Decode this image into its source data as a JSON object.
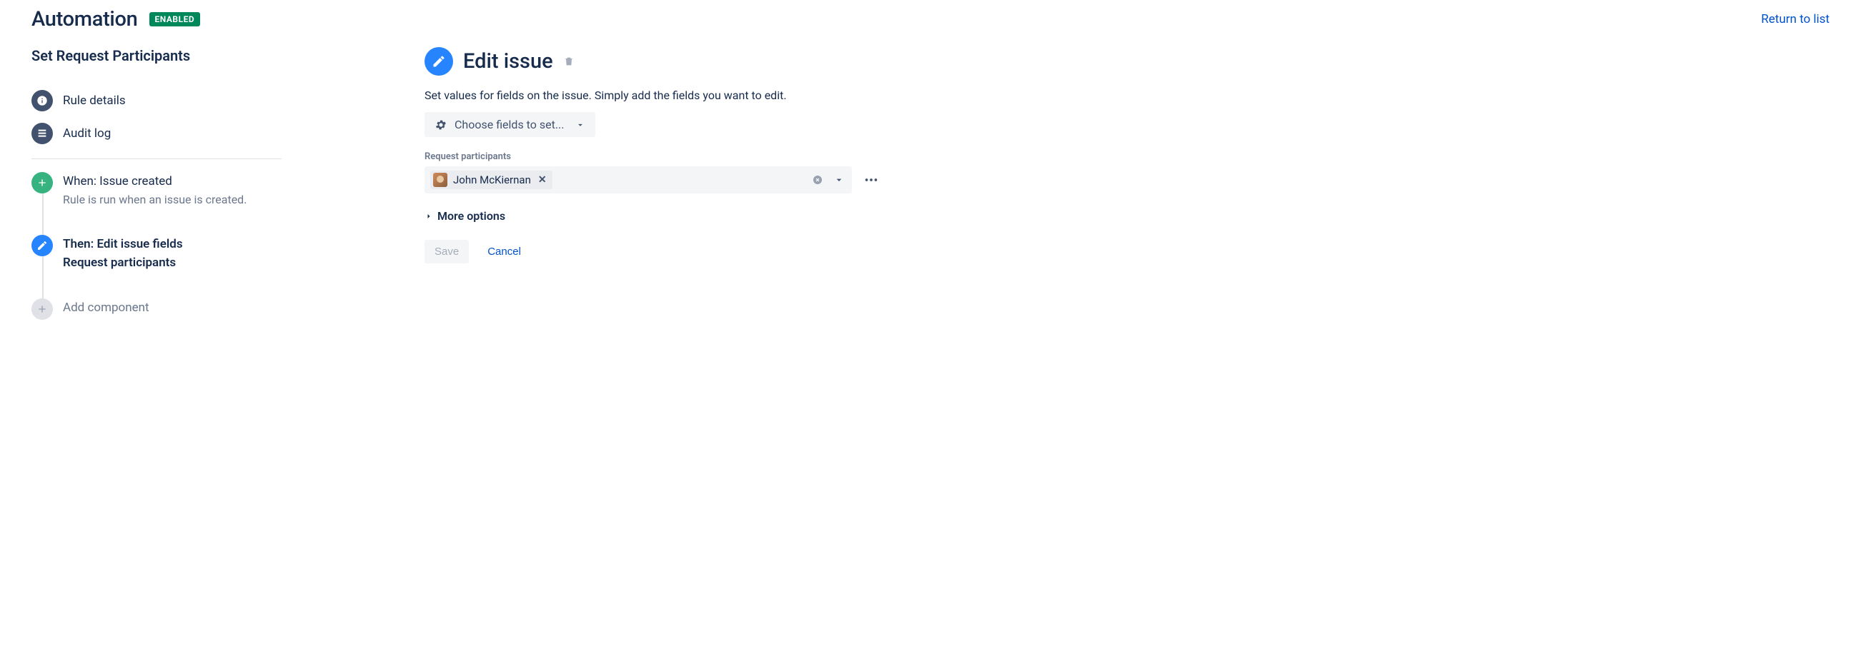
{
  "header": {
    "title": "Automation",
    "status_badge": "ENABLED",
    "return_link": "Return to list"
  },
  "sidebar": {
    "rule_name": "Set Request Participants",
    "menu": [
      {
        "label": "Rule details"
      },
      {
        "label": "Audit log"
      }
    ],
    "chain": {
      "when": {
        "title": "When: Issue created",
        "desc": "Rule is run when an issue is created."
      },
      "then": {
        "title": "Then: Edit issue fields",
        "sub": "Request participants"
      },
      "add": {
        "label": "Add component"
      }
    }
  },
  "panel": {
    "title": "Edit issue",
    "desc": "Set values for fields on the issue. Simply add the fields you want to edit.",
    "field_selector_label": "Choose fields to set...",
    "field_label": "Request participants",
    "participant_name": "John McKiernan",
    "more_options": "More options",
    "save_label": "Save",
    "cancel_label": "Cancel"
  }
}
